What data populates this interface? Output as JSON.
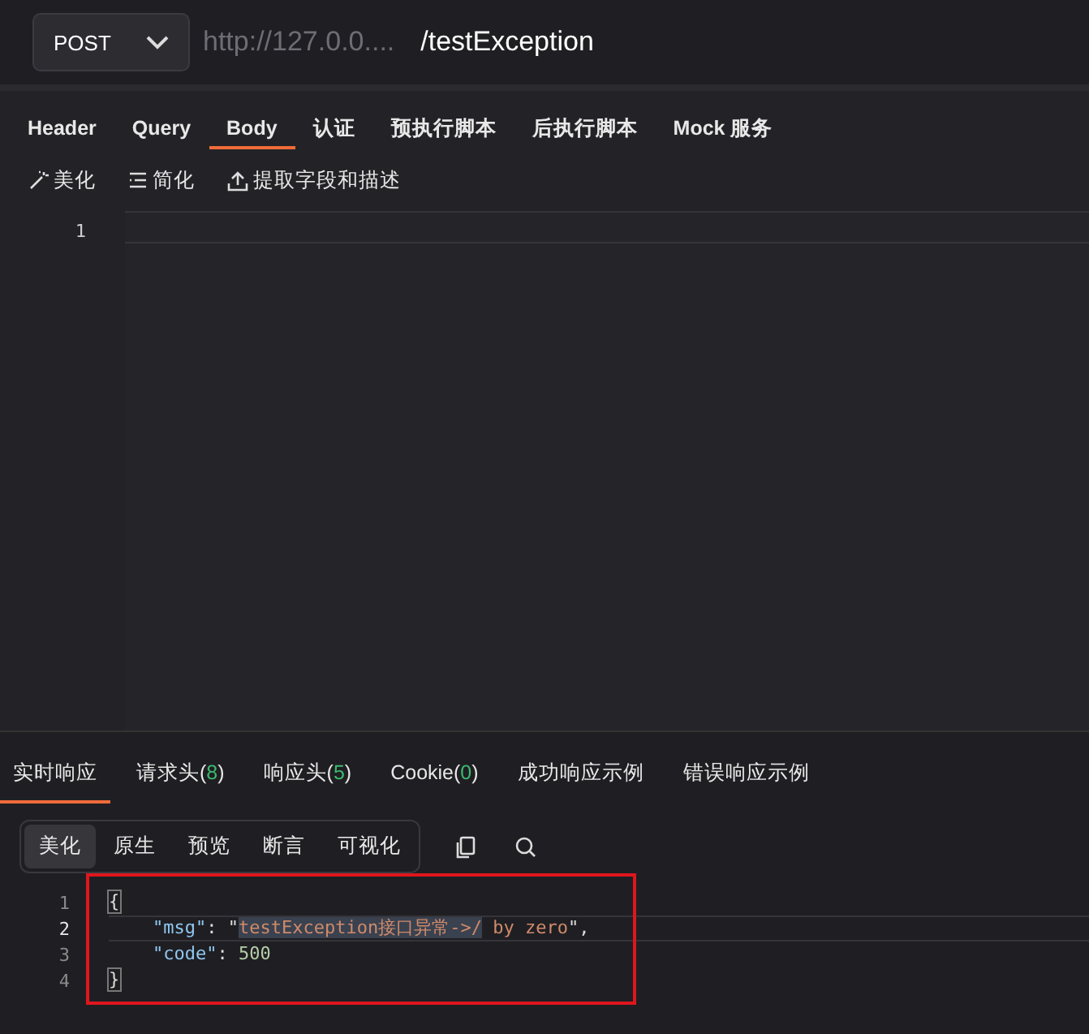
{
  "request": {
    "method": "POST",
    "base_url": "http://127.0.0....",
    "path": "/testException"
  },
  "request_tabs": [
    {
      "label": "Header",
      "selected": false
    },
    {
      "label": "Query",
      "selected": false
    },
    {
      "label": "Body",
      "selected": true
    },
    {
      "label": "认证",
      "selected": false
    },
    {
      "label": "预执行脚本",
      "selected": false
    },
    {
      "label": "后执行脚本",
      "selected": false
    },
    {
      "label": "Mock 服务",
      "selected": false
    }
  ],
  "body_toolbar": [
    {
      "label": "美化",
      "kind": "wand"
    },
    {
      "label": "简化",
      "kind": "list"
    },
    {
      "label": "提取字段和描述",
      "kind": "upload"
    }
  ],
  "body_editor": {
    "line_numbers": [
      "1"
    ]
  },
  "response_tabs": [
    {
      "label": "实时响应",
      "selected": true
    },
    {
      "label": "请求头(",
      "count": "8",
      "close": ")",
      "selected": false
    },
    {
      "label": "响应头(",
      "count": "5",
      "close": ")",
      "selected": false
    },
    {
      "label": "Cookie(",
      "count": "0",
      "close": ")",
      "selected": false
    },
    {
      "label": "成功响应示例",
      "selected": false
    },
    {
      "label": "错误响应示例",
      "selected": false
    }
  ],
  "view_modes": [
    {
      "label": "美化",
      "selected": true
    },
    {
      "label": "原生",
      "selected": false
    },
    {
      "label": "预览",
      "selected": false
    },
    {
      "label": "断言",
      "selected": false
    },
    {
      "label": "可视化",
      "selected": false
    }
  ],
  "response_code": [
    {
      "number": "1",
      "active": false,
      "tokens": [
        {
          "text": "{",
          "kind": "brace"
        }
      ]
    },
    {
      "number": "2",
      "active": true,
      "indented": true,
      "tokens": [
        {
          "text": "\"msg\"",
          "kind": "key"
        },
        {
          "text": ": \"",
          "kind": "punct"
        },
        {
          "text": "testException接口异常->/",
          "kind": "string",
          "selected": true
        },
        {
          "text": " by zero",
          "kind": "string",
          "selected": false
        },
        {
          "text": "\",",
          "kind": "punct"
        }
      ]
    },
    {
      "number": "3",
      "active": false,
      "indented": true,
      "tokens": [
        {
          "text": "\"code\"",
          "kind": "key"
        },
        {
          "text": ": ",
          "kind": "punct"
        },
        {
          "text": "500",
          "kind": "number"
        }
      ]
    },
    {
      "number": "4",
      "active": false,
      "tokens": [
        {
          "text": "}",
          "kind": "brace"
        }
      ]
    }
  ]
}
